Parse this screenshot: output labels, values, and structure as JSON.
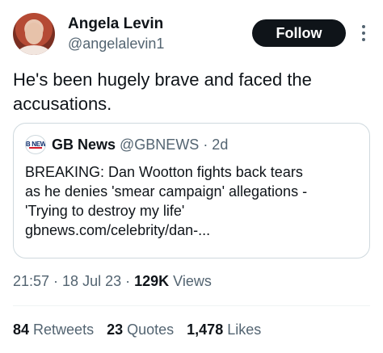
{
  "author": {
    "display_name": "Angela Levin",
    "handle": "@angelalevin1",
    "follow_label": "Follow"
  },
  "tweet": {
    "text": "He's been hugely brave and faced the accusations."
  },
  "quoted_tweet": {
    "logo_text": "GB NEWS",
    "display_name": "GB News",
    "handle": "@GBNEWS",
    "time": "· 2d",
    "text_line1": "BREAKING: Dan Wootton fights back tears",
    "text_line2": "as he denies 'smear campaign' allegations -",
    "text_line3": "'Trying to destroy my life'",
    "text_line4": "gbnews.com/celebrity/dan-..."
  },
  "meta": {
    "time": "21:57",
    "sep1": " · ",
    "date": "18 Jul 23",
    "sep2": " · ",
    "views_count": "129K",
    "views_label": " Views"
  },
  "stats": {
    "retweets_count": "84",
    "retweets_label": " Retweets",
    "quotes_count": "23",
    "quotes_label": " Quotes",
    "likes_count": "1,478",
    "likes_label": " Likes"
  },
  "colors": {
    "text": "#0f1419",
    "secondary": "#536471",
    "border": "#cfd9de",
    "button": "#0f1419"
  }
}
